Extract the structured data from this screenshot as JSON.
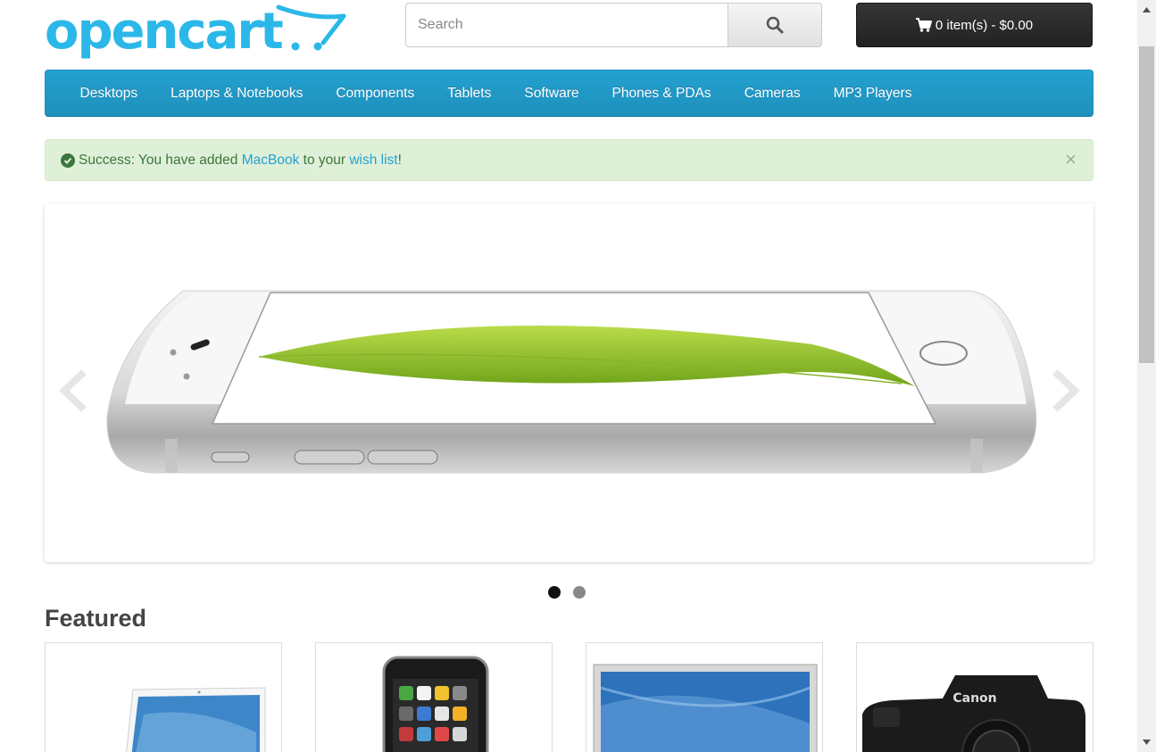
{
  "brand": {
    "logo_text": "opencart"
  },
  "search": {
    "placeholder": "Search",
    "value": "",
    "button_icon": "search-icon"
  },
  "cart": {
    "label": "0 item(s) - $0.00",
    "icon": "shopping-cart-icon"
  },
  "menu": {
    "items": [
      {
        "label": "Desktops"
      },
      {
        "label": "Laptops & Notebooks"
      },
      {
        "label": "Components"
      },
      {
        "label": "Tablets"
      },
      {
        "label": "Software"
      },
      {
        "label": "Phones & PDAs"
      },
      {
        "label": "Cameras"
      },
      {
        "label": "MP3 Players"
      }
    ]
  },
  "alert": {
    "prefix": "Success: You have added ",
    "product_link": "MacBook",
    "middle": " to your ",
    "wishlist_link": "wish list",
    "suffix": "!",
    "close_label": "×",
    "icon": "check-circle-icon"
  },
  "slideshow": {
    "slides_count": 2,
    "active_slide": 1,
    "image": "iphone-6-slide"
  },
  "featured": {
    "title": "Featured",
    "products": [
      {
        "image": "macbook-product-image"
      },
      {
        "image": "iphone-product-image"
      },
      {
        "image": "apple-cinema-display-image"
      },
      {
        "image": "canon-eos-5d-camera-image"
      }
    ]
  },
  "colors": {
    "menu_bg": "#229ac8",
    "alert_bg": "#dff0d8",
    "alert_text": "#3c763d",
    "link": "#23a1d1",
    "cart_bg": "#2b2b2b",
    "logo": "#2bb8e8"
  }
}
